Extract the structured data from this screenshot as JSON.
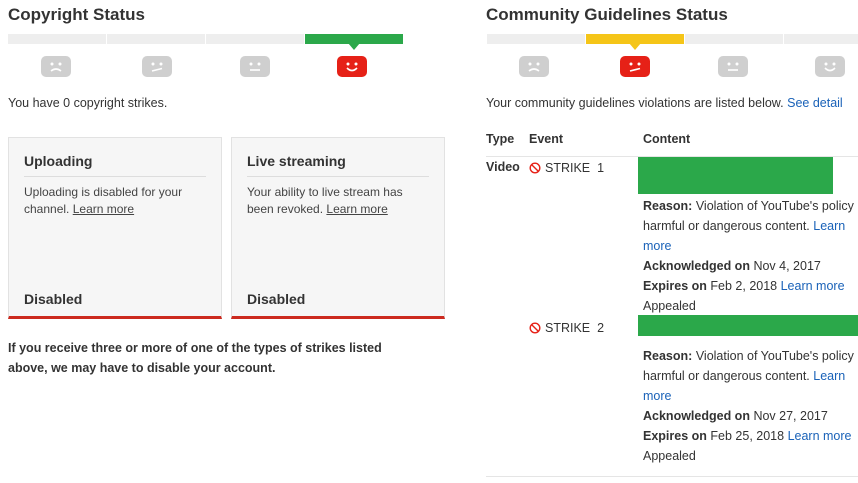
{
  "copyright": {
    "title": "Copyright Status",
    "strike_summary": "You have 0 copyright strikes.",
    "cards": [
      {
        "title": "Uploading",
        "body": "Uploading is disabled for your channel.",
        "link": "Learn more",
        "status": "Disabled"
      },
      {
        "title": "Live streaming",
        "body": "Your ability to live stream has been revoked.",
        "link": "Learn more",
        "status": "Disabled"
      }
    ],
    "warning": "If you receive three or more of one of the types of strikes listed above, we may have to disable your account.",
    "active_level": 4,
    "active_color": "#2ba84a"
  },
  "community": {
    "title": "Community Guidelines Status",
    "intro": "Your community guidelines violations are listed below.",
    "see_details": "See detail",
    "active_level": 2,
    "active_color": "#f5c518",
    "table": {
      "headers": {
        "type": "Type",
        "event": "Event",
        "content": "Content"
      },
      "rows": [
        {
          "type": "Video",
          "strike": "STRIKE  1",
          "reason_label": "Reason:",
          "reason_line1": "Violation of YouTube's policy",
          "reason_line2": "harmful or dangerous content.",
          "learn": "Learn",
          "more": "more",
          "ack_label": "Acknowledged on",
          "ack_date": "Nov 4, 2017",
          "exp_label": "Expires on",
          "exp_date": "Feb 2, 2018",
          "exp_link": "Learn more",
          "status": "Appealed"
        },
        {
          "type": "",
          "strike": "STRIKE  2",
          "reason_label": "Reason:",
          "reason_line1": "Violation of YouTube's policy",
          "reason_line2": "harmful or dangerous content.",
          "learn": "Learn",
          "more": "more",
          "ack_label": "Acknowledged on",
          "ack_date": "Nov 27, 2017",
          "exp_label": "Expires on",
          "exp_date": "Feb 25, 2018",
          "exp_link": "Learn more",
          "status": "Appealed"
        }
      ]
    }
  },
  "colors": {
    "green": "#2ba84a",
    "yellow": "#f5c518",
    "red": "#e62117",
    "link": "#1a62b8",
    "card_border": "#cc2a1f"
  }
}
